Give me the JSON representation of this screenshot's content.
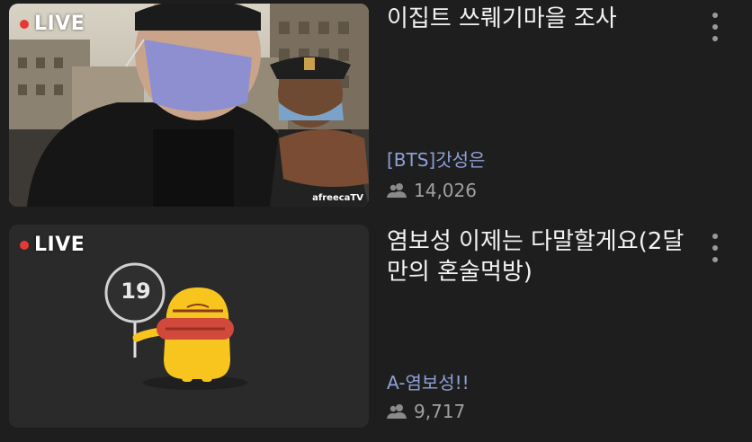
{
  "streams": [
    {
      "live_label": "LIVE",
      "title": "이집트 쓰뤠기마을 조사",
      "channel": "[BTS]갓성은",
      "viewers": "14,026",
      "watermark": "afreecaTV"
    },
    {
      "live_label": "LIVE",
      "title": "염보성 이제는 다말할게요(2달만의 혼술먹방)",
      "channel": "A-염보성!!",
      "viewers": "9,717",
      "age_badge": "19"
    }
  ],
  "colors": {
    "background": "#1e1e1e",
    "live_dot": "#e53935",
    "channel": "#8ea0d8",
    "viewers": "#a0a0a0",
    "character_yellow": "#f7c51e"
  },
  "icons": [
    "viewers-icon",
    "kebab-menu-icon",
    "live-dot-icon"
  ]
}
